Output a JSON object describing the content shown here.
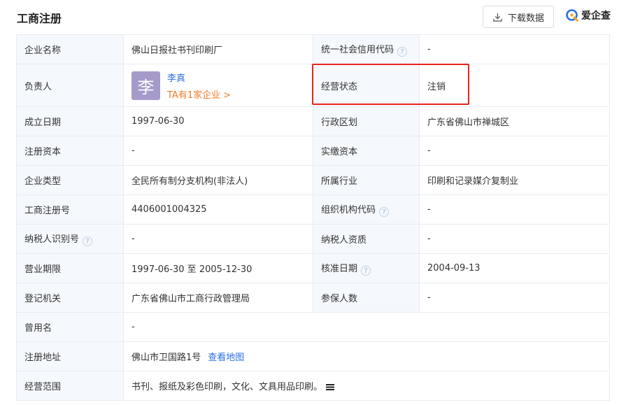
{
  "header": {
    "title": "工商注册",
    "download_label": "下载数据",
    "brand_name": "爱企查"
  },
  "table": {
    "company_name": {
      "label": "企业名称",
      "value": "佛山日报社书刊印刷厂"
    },
    "credit_code": {
      "label": "统一社会信用代码",
      "value": "-"
    },
    "legal_person": {
      "label": "负责人",
      "avatar_char": "李",
      "name": "李真",
      "link": "TA有1家企业 >"
    },
    "status": {
      "label": "经营状态",
      "value": "注销"
    },
    "founded": {
      "label": "成立日期",
      "value": "1997-06-30"
    },
    "region": {
      "label": "行政区划",
      "value": "广东省佛山市禅城区"
    },
    "reg_capital": {
      "label": "注册资本",
      "value": "-"
    },
    "paid_capital": {
      "label": "实缴资本",
      "value": "-"
    },
    "company_type": {
      "label": "企业类型",
      "value": "全民所有制分支机构(非法人)"
    },
    "industry": {
      "label": "所属行业",
      "value": "印刷和记录媒介复制业"
    },
    "reg_number": {
      "label": "工商注册号",
      "value": "4406001004325"
    },
    "org_code": {
      "label": "组织机构代码",
      "value": "-"
    },
    "taxpayer_id": {
      "label": "纳税人识别号",
      "value": "-"
    },
    "taxpayer_qual": {
      "label": "纳税人资质",
      "value": "-"
    },
    "business_term": {
      "label": "营业期限",
      "value": "1997-06-30 至 2005-12-30"
    },
    "approval_date": {
      "label": "核准日期",
      "value": "2004-09-13"
    },
    "authority": {
      "label": "登记机关",
      "value": "广东省佛山市工商行政管理局"
    },
    "insured": {
      "label": "参保人数",
      "value": "-"
    },
    "former_name": {
      "label": "曾用名",
      "value": "-"
    },
    "address": {
      "label": "注册地址",
      "value": "佛山市卫国路1号",
      "map_link": "查看地图"
    },
    "scope": {
      "label": "经营范围",
      "value": "书刊、报纸及彩色印刷，文化、文具用品印刷。"
    }
  },
  "colors": {
    "highlight": "#e8231f",
    "link": "#2b6ee5",
    "accent_orange": "#f07b24",
    "avatar": "#a59ac9"
  },
  "icons": {
    "download": "download-icon",
    "brand": "brand-logo-icon",
    "help": "question-circle-icon",
    "more": "more-icon"
  }
}
